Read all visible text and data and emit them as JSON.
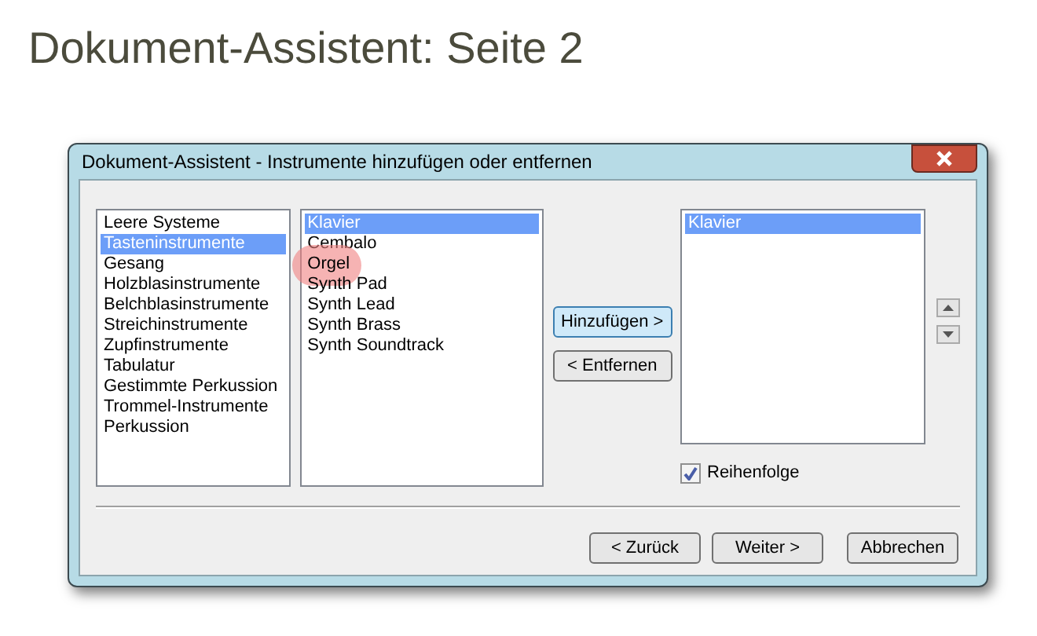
{
  "page_title": "Dokument-Assistent: Seite 2",
  "dialog": {
    "title": "Dokument-Assistent - Instrumente hinzufügen oder entfernen",
    "categories": [
      {
        "label": "Leere Systeme",
        "selected": false
      },
      {
        "label": "Tasteninstrumente",
        "selected": true
      },
      {
        "label": "Gesang",
        "selected": false
      },
      {
        "label": "Holzblasinstrumente",
        "selected": false
      },
      {
        "label": "Belchblasinstrumente",
        "selected": false
      },
      {
        "label": "Streichinstrumente",
        "selected": false
      },
      {
        "label": "Zupfinstrumente",
        "selected": false
      },
      {
        "label": "Tabulatur",
        "selected": false
      },
      {
        "label": "Gestimmte Perkussion",
        "selected": false
      },
      {
        "label": "Trommel-Instrumente",
        "selected": false
      },
      {
        "label": "Perkussion",
        "selected": false
      }
    ],
    "instruments": [
      {
        "label": "Klavier",
        "selected": true,
        "highlighted": false
      },
      {
        "label": "Cembalo",
        "selected": false,
        "highlighted": false
      },
      {
        "label": "Orgel",
        "selected": false,
        "highlighted": true
      },
      {
        "label": "Synth Pad",
        "selected": false,
        "highlighted": false
      },
      {
        "label": "Synth Lead",
        "selected": false,
        "highlighted": false
      },
      {
        "label": "Synth Brass",
        "selected": false,
        "highlighted": false
      },
      {
        "label": "Synth Soundtrack",
        "selected": false,
        "highlighted": false
      }
    ],
    "add_button": "Hinzufügen >",
    "remove_button": "< Entfernen",
    "chosen": [
      {
        "label": "Klavier",
        "selected": true
      }
    ],
    "order_checkbox": {
      "label": "Reihenfolge",
      "checked": true
    },
    "buttons": [
      "< Zurück",
      "Weiter >",
      "Abbrechen"
    ]
  }
}
